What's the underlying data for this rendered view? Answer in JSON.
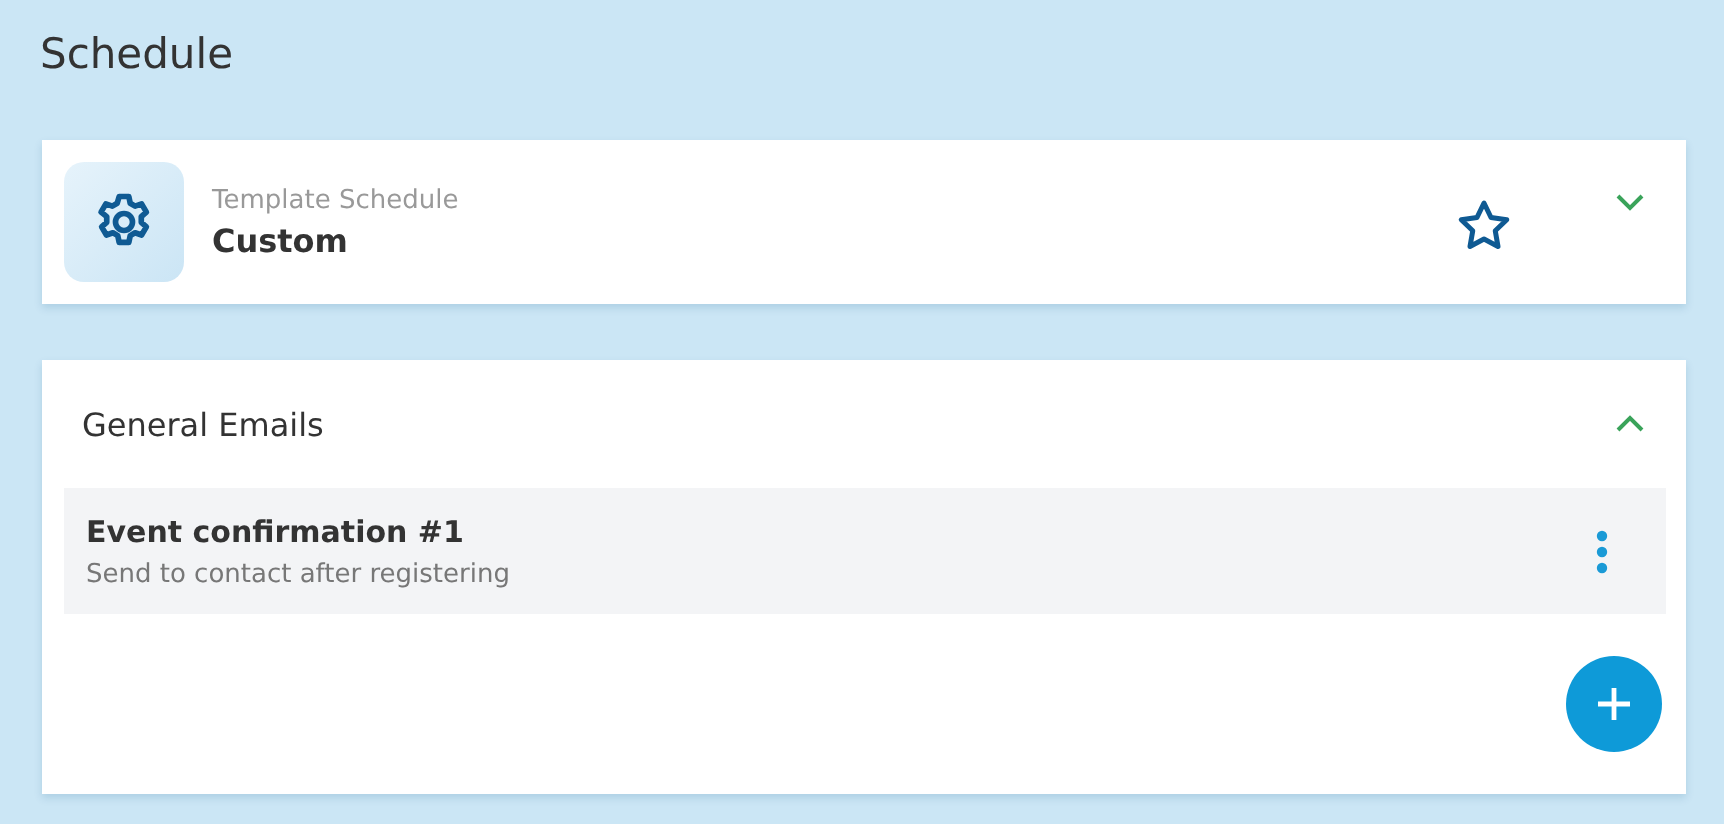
{
  "page_title": "Schedule",
  "template_card": {
    "label": "Template Schedule",
    "value": "Custom",
    "favorite": false,
    "expanded": false
  },
  "emails_section": {
    "title": "General Emails",
    "expanded": true,
    "items": [
      {
        "title": "Event confirmation #1",
        "subtitle": "Send to contact after registering"
      }
    ]
  }
}
